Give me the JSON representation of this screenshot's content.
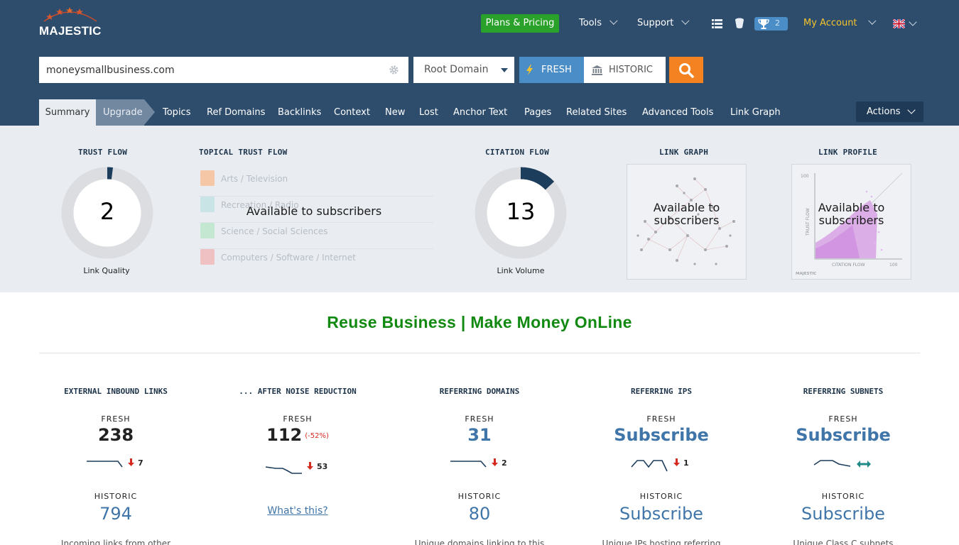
{
  "header": {
    "logo_text": "MAJESTIC",
    "plans_label": "Plans & Pricing",
    "nav": {
      "tools": "Tools",
      "support": "Support",
      "account": "My Account"
    },
    "trophy_count": "2",
    "colors": {
      "bg": "#2e4d6c",
      "accent_green": "#2aa12a",
      "accent_orange": "#f58220",
      "fresh_blue": "#4b8dc7",
      "account_yellow": "#f5c42c"
    }
  },
  "search": {
    "value": "moneysmallbusiness.com",
    "scope": "Root Domain",
    "fresh_label": "FRESH",
    "historic_label": "HISTORIC"
  },
  "tabs": [
    {
      "label": "Summary",
      "active": true
    },
    {
      "label": "Upgrade"
    },
    {
      "label": "Topics"
    },
    {
      "label": "Ref Domains"
    },
    {
      "label": "Backlinks"
    },
    {
      "label": "Context"
    },
    {
      "label": "New"
    },
    {
      "label": "Lost"
    },
    {
      "label": "Anchor Text"
    },
    {
      "label": "Pages"
    },
    {
      "label": "Related Sites"
    },
    {
      "label": "Advanced Tools"
    },
    {
      "label": "Link Graph"
    }
  ],
  "actions_label": "Actions",
  "metrics": {
    "trust_flow": {
      "title": "TRUST FLOW",
      "value": "2",
      "percent": 2,
      "caption": "Link Quality"
    },
    "topical": {
      "title": "TOPICAL TRUST FLOW",
      "overlay": "Available to subscribers",
      "topics": [
        {
          "label": "Arts / Television",
          "color": "#f5c7a6"
        },
        {
          "label": "Recreation / Radio",
          "color": "#c9e4e4"
        },
        {
          "label": "Science / Social Sciences",
          "color": "#c4e7d2"
        },
        {
          "label": "Computers / Software / Internet",
          "color": "#efc1c3"
        }
      ]
    },
    "citation_flow": {
      "title": "CITATION FLOW",
      "value": "13",
      "percent": 13,
      "caption": "Link Volume"
    },
    "link_graph": {
      "title": "LINK GRAPH",
      "overlay_line1": "Available to",
      "overlay_line2": "subscribers"
    },
    "link_profile": {
      "title": "LINK PROFILE",
      "overlay_line1": "Available to",
      "overlay_line2": "subscribers",
      "axis_y": "TRUST FLOW",
      "axis_x": "CITATION FLOW",
      "max": "100",
      "watermark": "MAJESTIC"
    }
  },
  "site_title": "Reuse Business | Make Money OnLine",
  "stats": [
    {
      "title": "EXTERNAL INBOUND LINKS",
      "fresh_label": "FRESH",
      "fresh_value": "238",
      "delta": "7",
      "historic_label": "HISTORIC",
      "historic_value": "794",
      "desc": "Incoming links from other"
    },
    {
      "title": "... AFTER NOISE REDUCTION",
      "fresh_label": "FRESH",
      "fresh_value": "112",
      "fresh_pct": "(-52%)",
      "delta": "53",
      "whats_this": "What's this?"
    },
    {
      "title": "REFERRING DOMAINS",
      "fresh_label": "FRESH",
      "fresh_value": "31",
      "delta": "2",
      "historic_label": "HISTORIC",
      "historic_value": "80",
      "desc": "Unique domains linking to this"
    },
    {
      "title": "REFERRING IPS",
      "fresh_label": "FRESH",
      "fresh_value": "Subscribe",
      "delta": "1",
      "historic_label": "HISTORIC",
      "historic_value": "Subscribe",
      "desc": "Unique IPs hosting referring"
    },
    {
      "title": "REFERRING SUBNETS",
      "fresh_label": "FRESH",
      "fresh_value": "Subscribe",
      "historic_label": "HISTORIC",
      "historic_value": "Subscribe",
      "desc": "Unique Class C subnets"
    }
  ]
}
